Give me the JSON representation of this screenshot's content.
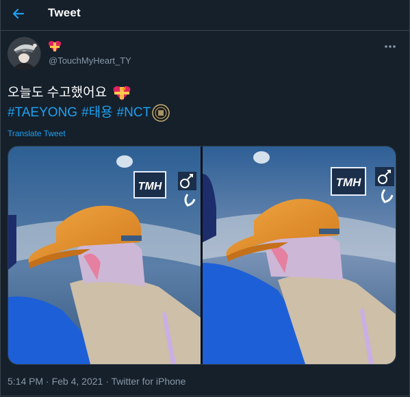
{
  "header": {
    "title": "Tweet"
  },
  "author": {
    "display_name_emoji": "heart-with-ribbon",
    "handle": "@TouchMyHeart_TY"
  },
  "tweet": {
    "text": "오늘도 수고했어요",
    "hashtags": [
      "#TAEYONG",
      "#태용",
      "#NCT"
    ],
    "translate_label": "Translate Tweet"
  },
  "media": {
    "watermark_text": "TMH"
  },
  "meta": {
    "time": "5:14 PM",
    "sep1": " · ",
    "date": "Feb 4, 2021",
    "sep2": " · ",
    "source": "Twitter for iPhone"
  },
  "colors": {
    "background": "#15202b",
    "accent": "#1da1f2",
    "secondary_text": "#8899a6",
    "border": "#38444d"
  }
}
